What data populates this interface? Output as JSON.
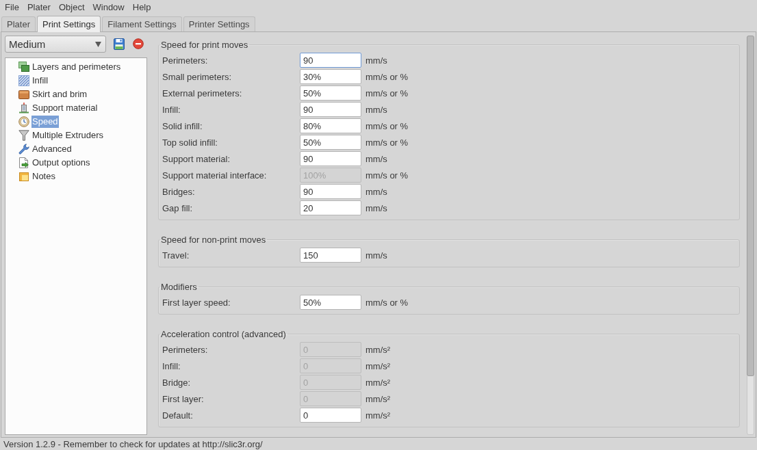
{
  "menu": [
    "File",
    "Plater",
    "Object",
    "Window",
    "Help"
  ],
  "tabs": [
    {
      "label": "Plater",
      "selected": false
    },
    {
      "label": "Print Settings",
      "selected": true
    },
    {
      "label": "Filament Settings",
      "selected": false
    },
    {
      "label": "Printer Settings",
      "selected": false
    }
  ],
  "preset": {
    "value": "Medium"
  },
  "categories": [
    {
      "label": "Layers and perimeters",
      "selected": false
    },
    {
      "label": "Infill",
      "selected": false
    },
    {
      "label": "Skirt and brim",
      "selected": false
    },
    {
      "label": "Support material",
      "selected": false
    },
    {
      "label": "Speed",
      "selected": true
    },
    {
      "label": "Multiple Extruders",
      "selected": false
    },
    {
      "label": "Advanced",
      "selected": false
    },
    {
      "label": "Output options",
      "selected": false
    },
    {
      "label": "Notes",
      "selected": false
    }
  ],
  "groups": [
    {
      "title": "Speed for print moves",
      "fields": [
        {
          "label": "Perimeters:",
          "value": "90",
          "unit": "mm/s",
          "disabled": false,
          "focused": true
        },
        {
          "label": "Small perimeters:",
          "value": "30%",
          "unit": "mm/s or %",
          "disabled": false,
          "focused": false
        },
        {
          "label": "External perimeters:",
          "value": "50%",
          "unit": "mm/s or %",
          "disabled": false,
          "focused": false
        },
        {
          "label": "Infill:",
          "value": "90",
          "unit": "mm/s",
          "disabled": false,
          "focused": false
        },
        {
          "label": "Solid infill:",
          "value": "80%",
          "unit": "mm/s or %",
          "disabled": false,
          "focused": false
        },
        {
          "label": "Top solid infill:",
          "value": "50%",
          "unit": "mm/s or %",
          "disabled": false,
          "focused": false
        },
        {
          "label": "Support material:",
          "value": "90",
          "unit": "mm/s",
          "disabled": false,
          "focused": false
        },
        {
          "label": "Support material interface:",
          "value": "100%",
          "unit": "mm/s or %",
          "disabled": true,
          "focused": false
        },
        {
          "label": "Bridges:",
          "value": "90",
          "unit": "mm/s",
          "disabled": false,
          "focused": false
        },
        {
          "label": "Gap fill:",
          "value": "20",
          "unit": "mm/s",
          "disabled": false,
          "focused": false
        }
      ]
    },
    {
      "title": "Speed for non-print moves",
      "fields": [
        {
          "label": "Travel:",
          "value": "150",
          "unit": "mm/s",
          "disabled": false,
          "focused": false
        }
      ]
    },
    {
      "title": "Modifiers",
      "fields": [
        {
          "label": "First layer speed:",
          "value": "50%",
          "unit": "mm/s or %",
          "disabled": false,
          "focused": false
        }
      ]
    },
    {
      "title": "Acceleration control (advanced)",
      "fields": [
        {
          "label": "Perimeters:",
          "value": "0",
          "unit": "mm/s²",
          "disabled": true,
          "focused": false
        },
        {
          "label": "Infill:",
          "value": "0",
          "unit": "mm/s²",
          "disabled": true,
          "focused": false
        },
        {
          "label": "Bridge:",
          "value": "0",
          "unit": "mm/s²",
          "disabled": true,
          "focused": false
        },
        {
          "label": "First layer:",
          "value": "0",
          "unit": "mm/s²",
          "disabled": true,
          "focused": false
        },
        {
          "label": "Default:",
          "value": "0",
          "unit": "mm/s²",
          "disabled": false,
          "focused": false
        }
      ]
    }
  ],
  "status_bar": {
    "text": "Version 1.2.9 - Remember to check for updates at http://slic3r.org/"
  }
}
